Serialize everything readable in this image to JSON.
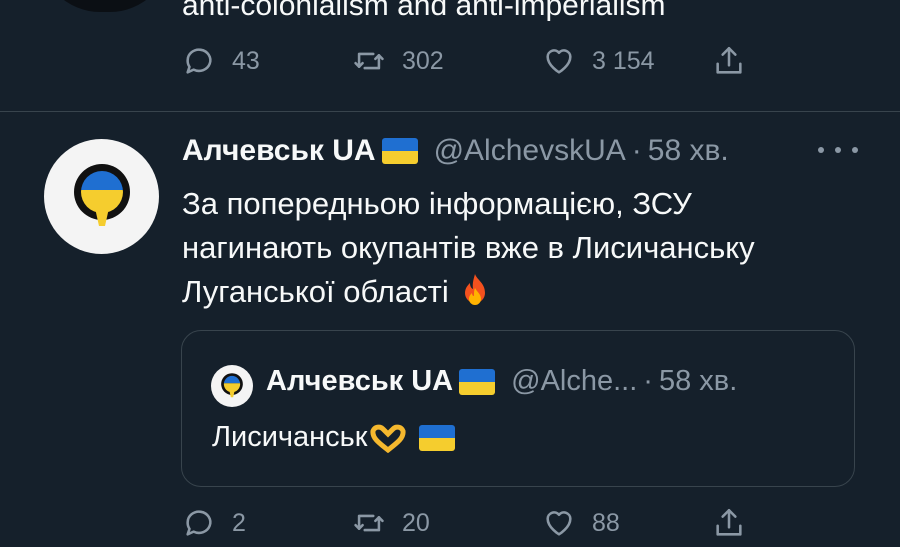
{
  "previous_tweet": {
    "text": "anti-colonialism and anti-imperialism",
    "actions": {
      "replies": "43",
      "retweets": "302",
      "likes": "3 154"
    }
  },
  "tweet": {
    "author_name": "Алчевськ UA",
    "handle": "@AlchevskUA",
    "separator": "·",
    "time": "58 хв.",
    "lines": [
      "За попередньою інформацією, ЗСУ",
      "нагинають окупантів вже в Лисичанську",
      "Луганської області"
    ],
    "quote": {
      "author_name": "Алчевськ UA",
      "handle": "@Alche...",
      "separator": "·",
      "time": "58 хв.",
      "text": "Лисичанськ"
    },
    "actions": {
      "replies": "2",
      "retweets": "20",
      "likes": "88"
    }
  },
  "icons": {
    "reply": "speech-bubble-icon",
    "retweet": "retweet-icon",
    "like": "heart-icon",
    "share": "share-icon",
    "more": "more-dots-icon",
    "fire": "fire-emoji",
    "heart_hands": "heart-hands-emoji",
    "flag": "ukraine-flag"
  },
  "colors": {
    "background": "#15202b",
    "text": "#f7f9f9",
    "muted": "#8b98a5",
    "border": "#38444d",
    "flag_blue": "#1f6fd1",
    "flag_yellow": "#f5cd2e"
  }
}
